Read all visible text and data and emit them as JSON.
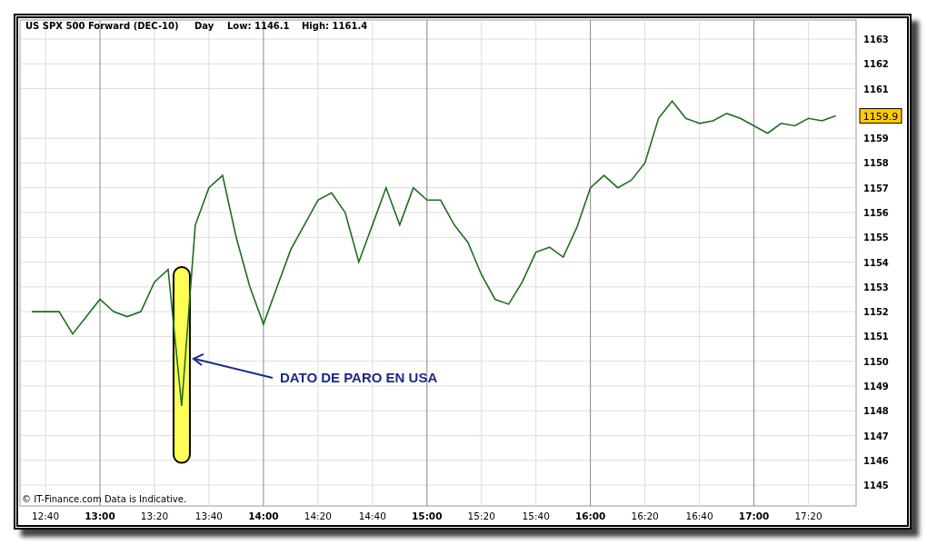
{
  "header": {
    "instrument": "US SPX 500 Forward (DEC-10)",
    "period": "Day",
    "low": "Low: 1146.1",
    "high": "High: 1161.4"
  },
  "chart_data": {
    "type": "line",
    "grid": true,
    "categories": [
      null,
      "12:40",
      null,
      null,
      null,
      "13:00",
      null,
      null,
      null,
      "13:20",
      null,
      null,
      null,
      "13:40",
      null,
      null,
      null,
      "14:00",
      null,
      null,
      null,
      "14:20",
      null,
      null,
      null,
      "14:40",
      null,
      null,
      null,
      "15:00",
      null,
      null,
      null,
      "15:20",
      null,
      null,
      null,
      "15:40",
      null,
      null,
      null,
      "16:00",
      null,
      null,
      null,
      "16:20",
      null,
      null,
      null,
      "16:40",
      null,
      null,
      null,
      "17:00",
      null,
      null,
      null,
      "17:20",
      null,
      null
    ],
    "series": [
      {
        "color": "#1e6e1e",
        "values": [
          1152,
          1152,
          1152,
          1151.1,
          1151.8,
          1152.5,
          1152,
          1151.8,
          1152,
          1153.2,
          1153.7,
          1148.2,
          1155.5,
          1157,
          1157.5,
          1155,
          1153,
          1151.5,
          1153,
          1154.5,
          1155.5,
          1156.5,
          1156.8,
          1156,
          1154,
          1155.5,
          1157,
          1155.5,
          1157,
          1156.5,
          1156.5,
          1155.5,
          1154.8,
          1153.5,
          1152.5,
          1152.3,
          1153.2,
          1154.4,
          1154.6,
          1154.2,
          1155.4,
          1157,
          1157.5,
          1157,
          1157.3,
          1158,
          1159.8,
          1160.5,
          1159.8,
          1159.6,
          1159.7,
          1160,
          1159.8,
          1159.5,
          1159.2,
          1159.6,
          1159.5,
          1159.8,
          1159.7,
          1159.9
        ]
      }
    ],
    "ylim": [
      1144.16,
      1163.77
    ],
    "yticks": [
      1145,
      1146,
      1147,
      1148,
      1149,
      1150,
      1151,
      1152,
      1153,
      1154,
      1155,
      1156,
      1157,
      1158,
      1159,
      1161,
      1162,
      1163
    ],
    "annotations": [
      "DATO DE PARO EN USA"
    ]
  },
  "last_price": "1159.9",
  "disclaimer": "© IT-Finance.com Data is Indicative."
}
